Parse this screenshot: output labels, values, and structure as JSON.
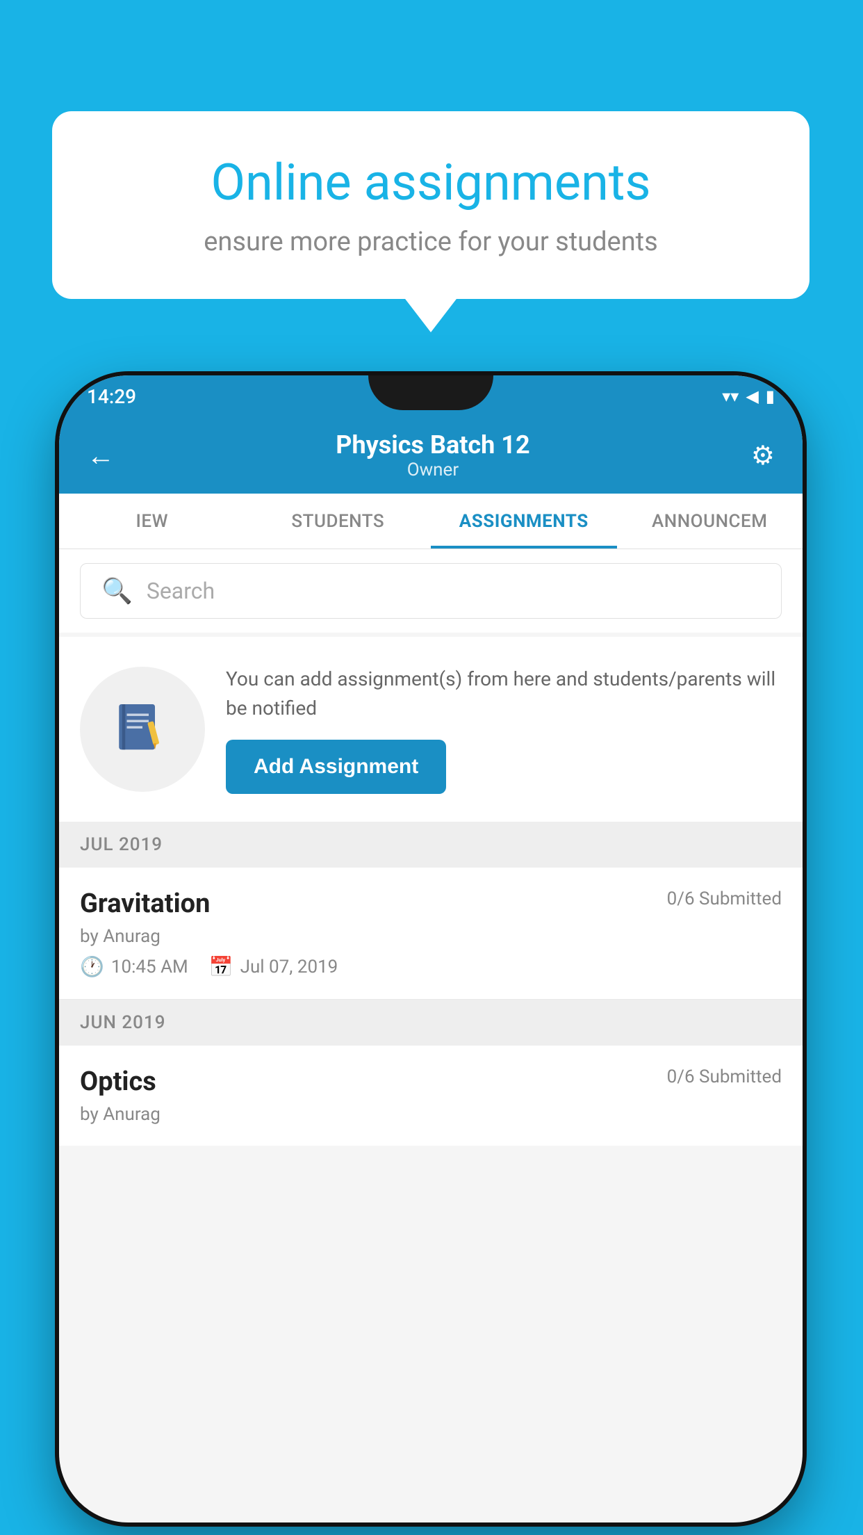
{
  "background": {
    "color": "#19b3e6"
  },
  "speech_bubble": {
    "title": "Online assignments",
    "subtitle": "ensure more practice for your students"
  },
  "status_bar": {
    "time": "14:29",
    "wifi_icon": "wifi",
    "signal_icon": "signal",
    "battery_icon": "battery"
  },
  "app_header": {
    "back_label": "←",
    "title": "Physics Batch 12",
    "subtitle": "Owner",
    "settings_icon": "gear"
  },
  "tabs": [
    {
      "label": "IEW",
      "active": false
    },
    {
      "label": "STUDENTS",
      "active": false
    },
    {
      "label": "ASSIGNMENTS",
      "active": true
    },
    {
      "label": "ANNOUNCEM",
      "active": false
    }
  ],
  "search": {
    "placeholder": "Search"
  },
  "add_assignment": {
    "info_text": "You can add assignment(s) from here and students/parents will be notified",
    "button_label": "Add Assignment"
  },
  "sections": [
    {
      "header": "JUL 2019",
      "assignments": [
        {
          "name": "Gravitation",
          "submitted": "0/6 Submitted",
          "by": "by Anurag",
          "time": "10:45 AM",
          "date": "Jul 07, 2019"
        }
      ]
    },
    {
      "header": "JUN 2019",
      "assignments": [
        {
          "name": "Optics",
          "submitted": "0/6 Submitted",
          "by": "by Anurag",
          "time": "",
          "date": ""
        }
      ]
    }
  ]
}
